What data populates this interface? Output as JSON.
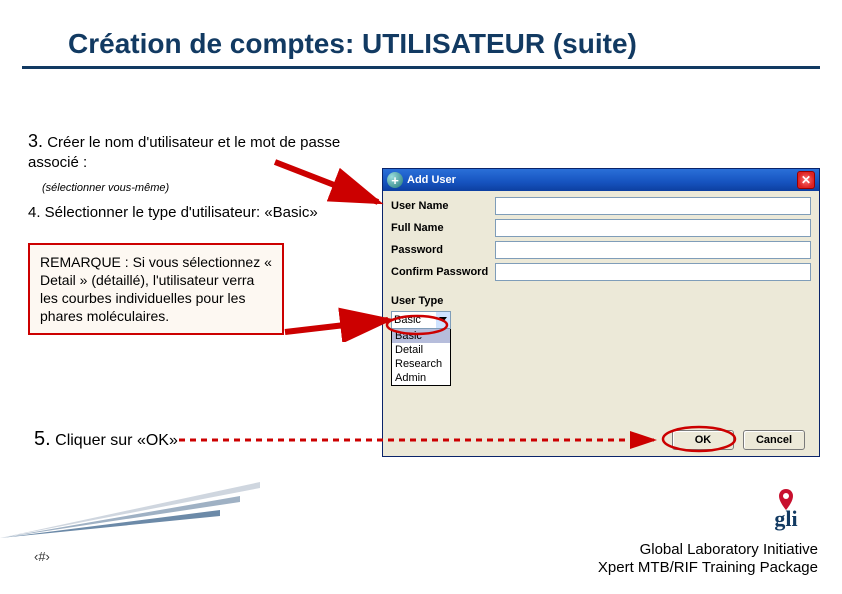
{
  "title": "Création de comptes: UTILISATEUR (suite)",
  "steps": {
    "s3_num": "3.",
    "s3_text": "Créer le nom d'utilisateur et le mot de passe  associé :",
    "s3_hint": "(sélectionner vous-même)",
    "s4_text": "4. Sélectionner le type d'utilisateur: «Basic»",
    "note": "REMARQUE : Si vous sélectionnez « Detail » (détaillé), l'utilisateur verra les courbes individuelles pour les phares moléculaires.",
    "s5_num": "5.",
    "s5_text": "Cliquer sur «OK»"
  },
  "dialog": {
    "title": "Add User",
    "icon_glyph": "+",
    "labels": {
      "username": "User Name",
      "fullname": "Full Name",
      "password": "Password",
      "confirm": "Confirm Password",
      "usertype": "User Type"
    },
    "fields": {
      "username": "",
      "fullname": "",
      "password": "",
      "confirm": ""
    },
    "dropdown": {
      "selected": "Basic",
      "options": [
        "Basic",
        "Detail",
        "Research",
        "Admin"
      ]
    },
    "buttons": {
      "ok": "OK",
      "cancel": "Cancel"
    }
  },
  "footer": {
    "line1": "Global Laboratory Initiative",
    "line2": "Xpert MTB/RIF Training Package",
    "logo_label": "gli"
  },
  "page_number": "‹#›"
}
